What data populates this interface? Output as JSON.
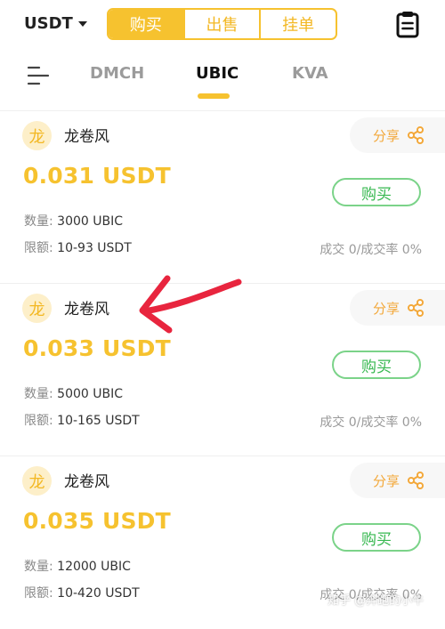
{
  "header": {
    "currency": "USDT",
    "segments": [
      "购买",
      "出售",
      "挂单"
    ],
    "active_segment": 0
  },
  "tabs": {
    "items": [
      "DMCH",
      "UBIC",
      "KVA"
    ],
    "active": "UBIC"
  },
  "cards": [
    {
      "avatar": "龙",
      "seller": "龙卷风",
      "share_label": "分享",
      "price": "0.031 USDT",
      "buy_label": "购买",
      "quantity_key": "数量:",
      "quantity_value": "3000 UBIC",
      "limit_key": "限额:",
      "limit_value": "10-93 USDT",
      "stats": "成交 0/成交率 0%"
    },
    {
      "avatar": "龙",
      "seller": "龙卷风",
      "share_label": "分享",
      "price": "0.033 USDT",
      "buy_label": "购买",
      "quantity_key": "数量:",
      "quantity_value": "5000 UBIC",
      "limit_key": "限额:",
      "limit_value": "10-165 USDT",
      "stats": "成交 0/成交率 0%"
    },
    {
      "avatar": "龙",
      "seller": "龙卷风",
      "share_label": "分享",
      "price": "0.035 USDT",
      "buy_label": "购买",
      "quantity_key": "数量:",
      "quantity_value": "12000 UBIC",
      "limit_key": "限额:",
      "limit_value": "10-420 USDT",
      "stats": "成交 0/成交率 0%"
    }
  ],
  "watermark": "知乎 @奔跑的小牛",
  "colors": {
    "accent": "#f6c22f",
    "buy_green": "#37b850",
    "share_orange": "#f3a83a",
    "annotation_red": "#e8253e"
  },
  "icons": {
    "clipboard": "clipboard-icon",
    "menu": "menu-icon",
    "share": "share-icon",
    "caret": "caret-down-icon"
  }
}
